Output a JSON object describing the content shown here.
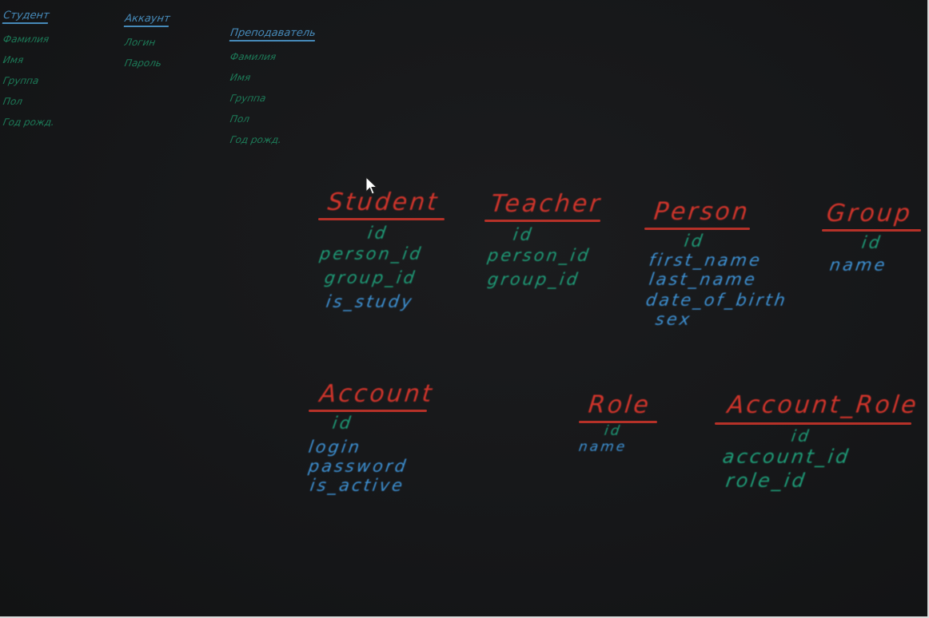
{
  "notes": [
    {
      "title": "Студент",
      "items": [
        "Фамилия",
        "Имя",
        "Группа",
        "Пол",
        "Год рожд."
      ]
    },
    {
      "title": "Аккаунт",
      "items": [
        "Логин",
        "Пароль"
      ]
    },
    {
      "title": "Преподаватель",
      "items": [
        "Фамилия",
        "Имя",
        "Группа",
        "Пол",
        "Год рожд."
      ]
    }
  ],
  "entities": {
    "student": {
      "title": "Student",
      "fields": [
        "id",
        "person_id",
        "group_id",
        "is_study"
      ]
    },
    "teacher": {
      "title": "Teacher",
      "fields": [
        "id",
        "person_id",
        "group_id"
      ]
    },
    "person": {
      "title": "Person",
      "fields": [
        "id",
        "first_name",
        "last_name",
        "date_of_birth",
        "sex"
      ]
    },
    "group": {
      "title": "Group",
      "fields": [
        "id",
        "name"
      ]
    },
    "account": {
      "title": "Account",
      "fields": [
        "id",
        "login",
        "password",
        "is_active"
      ]
    },
    "role": {
      "title": "Role",
      "fields": [
        "id",
        "name"
      ]
    },
    "account_role": {
      "title": "Account_Role",
      "fields": [
        "id",
        "account_id",
        "role_id"
      ]
    }
  },
  "colors": {
    "board": "#161719",
    "title_red": "#d8362c",
    "field_green": "#1e9a76",
    "field_blue": "#3d90d2"
  }
}
